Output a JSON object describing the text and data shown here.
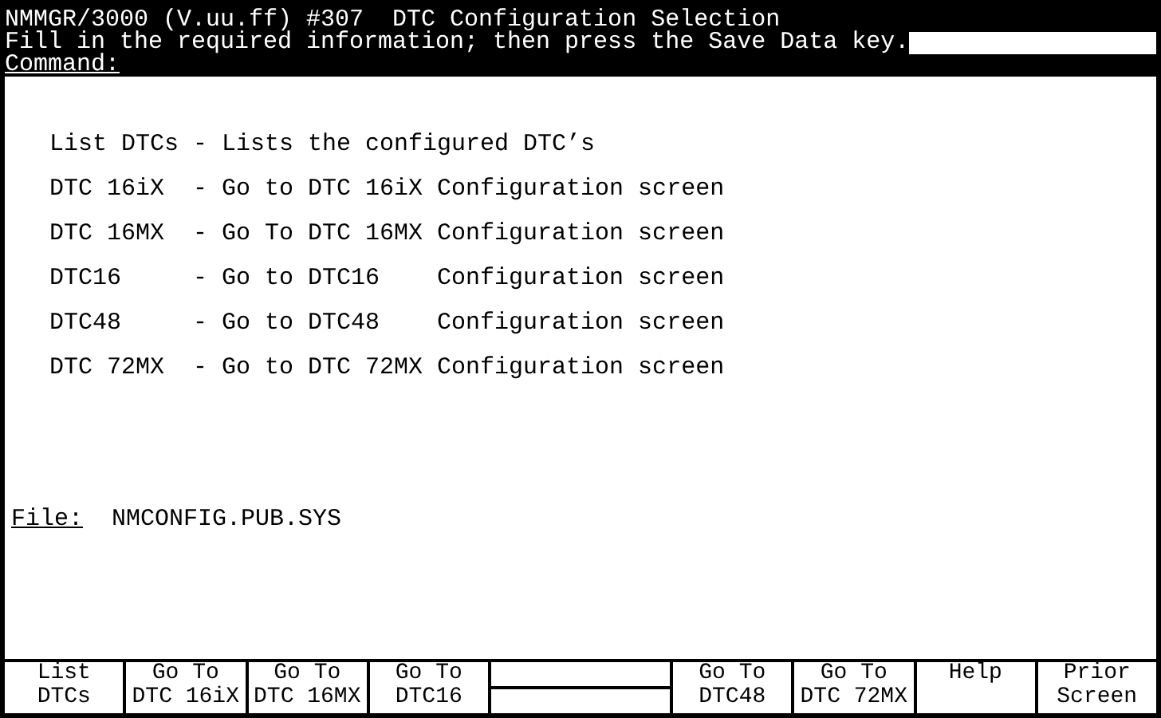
{
  "header": {
    "title": "NMMGR/3000 (V.uu.ff) #307  DTC Configuration Selection",
    "message": "Fill in the required information; then press the Save Data key.",
    "command_label": "Command:"
  },
  "menu": [
    "List DTCs - Lists the configured DTC’s",
    "DTC 16iX  - Go to DTC 16iX Configuration screen",
    "DTC 16MX  - Go To DTC 16MX Configuration screen",
    "DTC16     - Go to DTC16    Configuration screen",
    "DTC48     - Go to DTC48    Configuration screen",
    "DTC 72MX  - Go to DTC 72MX Configuration screen"
  ],
  "file": {
    "label": "File:",
    "value": "NMCONFIG.PUB.SYS"
  },
  "function_keys": [
    {
      "kind": "label",
      "lines": [
        "List",
        "DTCs"
      ]
    },
    {
      "kind": "label",
      "lines": [
        "Go To",
        "DTC 16iX"
      ]
    },
    {
      "kind": "label",
      "lines": [
        "Go To",
        "DTC 16MX"
      ]
    },
    {
      "kind": "label",
      "lines": [
        "Go To",
        "DTC16"
      ]
    },
    {
      "kind": "blank"
    },
    {
      "kind": "label",
      "lines": [
        "Go To",
        "DTC48"
      ]
    },
    {
      "kind": "label",
      "lines": [
        "Go To",
        "DTC 72MX"
      ]
    },
    {
      "kind": "label",
      "lines": [
        "Help"
      ]
    },
    {
      "kind": "label",
      "lines": [
        "Prior",
        "Screen"
      ]
    }
  ]
}
